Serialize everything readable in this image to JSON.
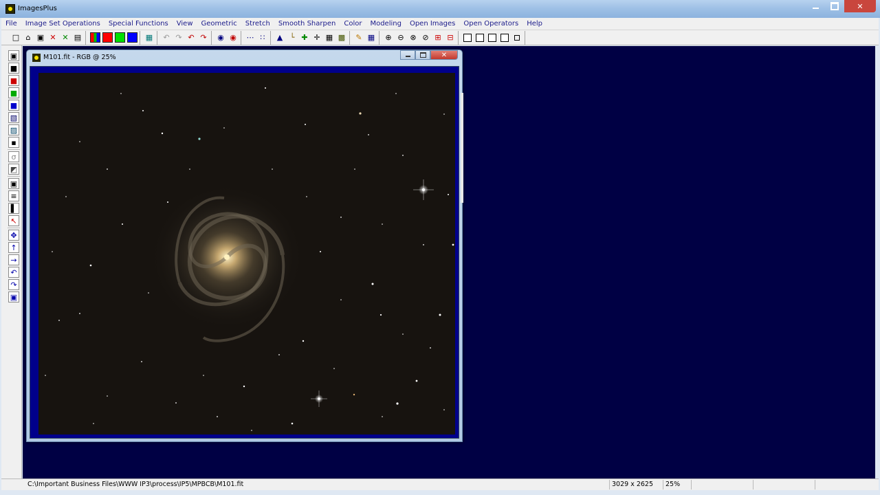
{
  "app": {
    "title": "ImagesPlus"
  },
  "menu": [
    "File",
    "Image Set Operations",
    "Special Functions",
    "View",
    "Geometric",
    "Stretch",
    "Smooth Sharpen",
    "Color",
    "Modeling",
    "Open Images",
    "Open Operators",
    "Help"
  ],
  "toolbar": {
    "items": [
      {
        "name": "new-icon",
        "glyph": "□"
      },
      {
        "name": "open-folder-icon",
        "glyph": "⌂"
      },
      {
        "name": "save-icon",
        "glyph": "▣"
      },
      {
        "name": "close-red-x-icon",
        "glyph": "✕",
        "color": "#cc0000"
      },
      {
        "name": "close-green-x-icon",
        "glyph": "✕",
        "color": "#008800"
      },
      {
        "name": "print-icon",
        "glyph": "▤"
      },
      {
        "name": "rgb-channels-icon",
        "kind": "rgb"
      },
      {
        "name": "red-channel-icon",
        "kind": "red"
      },
      {
        "name": "green-channel-icon",
        "kind": "green"
      },
      {
        "name": "blue-channel-icon",
        "kind": "blue"
      },
      {
        "name": "monitor-icon",
        "glyph": "▦",
        "color": "#007777"
      },
      {
        "name": "undo-all-icon",
        "glyph": "↶",
        "color": "#999999"
      },
      {
        "name": "redo-all-icon",
        "glyph": "↷",
        "color": "#999999"
      },
      {
        "name": "undo-icon",
        "glyph": "↶",
        "color": "#c00000"
      },
      {
        "name": "redo-icon",
        "glyph": "↷",
        "color": "#c00000"
      },
      {
        "name": "target-blue-icon",
        "glyph": "◉",
        "color": "#000080"
      },
      {
        "name": "target-red-icon",
        "glyph": "◉",
        "color": "#c00000"
      },
      {
        "name": "dots-line-icon",
        "glyph": "⋯",
        "color": "#000080"
      },
      {
        "name": "dots-grid-icon",
        "glyph": "∷",
        "color": "#000080"
      },
      {
        "name": "histogram-icon",
        "glyph": "▲",
        "color": "#000080"
      },
      {
        "name": "curve-icon",
        "glyph": "└",
        "color": "#806000"
      },
      {
        "name": "crosshair-green-icon",
        "glyph": "✚",
        "color": "#008800"
      },
      {
        "name": "crosshair-icon",
        "glyph": "✛",
        "color": "#000000"
      },
      {
        "name": "grid-calc-icon",
        "glyph": "▦",
        "color": "#000000"
      },
      {
        "name": "picture-icon",
        "glyph": "▩",
        "color": "#445500"
      },
      {
        "name": "pencil-icon",
        "glyph": "✎",
        "color": "#bb7700"
      },
      {
        "name": "table-icon",
        "glyph": "▦",
        "color": "#000080"
      },
      {
        "name": "zoom-in-icon",
        "glyph": "⊕",
        "color": "#000000"
      },
      {
        "name": "zoom-out-icon",
        "glyph": "⊖",
        "color": "#000000"
      },
      {
        "name": "zoom-fit-icon",
        "glyph": "⊗",
        "color": "#000000"
      },
      {
        "name": "zoom-actual-icon",
        "glyph": "⊘",
        "color": "#000000"
      },
      {
        "name": "add-panel-icon",
        "glyph": "⊞",
        "color": "#cc0000"
      },
      {
        "name": "remove-panel-icon",
        "glyph": "⊟",
        "color": "#cc0000"
      },
      {
        "name": "window-1-icon",
        "kind": "box"
      },
      {
        "name": "window-2-icon",
        "kind": "box"
      },
      {
        "name": "window-3-icon",
        "kind": "box"
      },
      {
        "name": "window-4-icon",
        "kind": "box"
      },
      {
        "name": "window-small-icon",
        "kind": "small-box"
      }
    ]
  },
  "left_tools": [
    {
      "name": "save-tool-icon",
      "glyph": "▣"
    },
    {
      "name": "copy-tool-icon",
      "glyph": "■"
    },
    {
      "name": "red-box-tool-icon",
      "glyph": "■",
      "color": "#cc0000"
    },
    {
      "name": "green-box-tool-icon",
      "glyph": "■",
      "color": "#00aa00"
    },
    {
      "name": "blue-box-tool-icon",
      "glyph": "■",
      "color": "#0000cc"
    },
    {
      "name": "layers-tool-icon",
      "glyph": "▧",
      "color": "#000066"
    },
    {
      "name": "mask-tool-icon",
      "glyph": "▨",
      "color": "#004466"
    },
    {
      "name": "crop-tool-icon",
      "glyph": "▪"
    },
    {
      "name": "sep-1",
      "sep": true
    },
    {
      "name": "gamma-tool-icon",
      "glyph": "σ",
      "color": "#888888"
    },
    {
      "name": "gradient-tool-icon",
      "glyph": "◩",
      "color": "#444444"
    },
    {
      "name": "sep-2",
      "sep": true
    },
    {
      "name": "select-tool-icon",
      "glyph": "▣"
    },
    {
      "name": "align-tool-icon",
      "glyph": "≡"
    },
    {
      "name": "bar-tool-icon",
      "glyph": "▌"
    },
    {
      "name": "pointer-tool-icon",
      "glyph": "↖",
      "color": "#cc0000"
    },
    {
      "name": "sep-3",
      "sep": true
    },
    {
      "name": "move-tool-icon",
      "glyph": "✥",
      "color": "#0000aa"
    },
    {
      "name": "up-arrow-tool-icon",
      "glyph": "↑",
      "color": "#0000aa"
    },
    {
      "name": "right-arrow-tool-icon",
      "glyph": "→",
      "color": "#0000aa"
    },
    {
      "name": "rotate-left-tool-icon",
      "glyph": "↶",
      "color": "#0000aa"
    },
    {
      "name": "rotate-right-tool-icon",
      "glyph": "↷",
      "color": "#0000aa"
    },
    {
      "name": "transform-tool-icon",
      "glyph": "▣",
      "color": "#0000aa"
    }
  ],
  "document": {
    "title": "M101.fit - RGB @ 25%"
  },
  "status": {
    "path": "C:\\Important Business Files\\WWW IP3\\process\\IP5\\MPBCB\\M101.fit",
    "dimensions": "3029 x 2625",
    "zoom": "25%"
  }
}
